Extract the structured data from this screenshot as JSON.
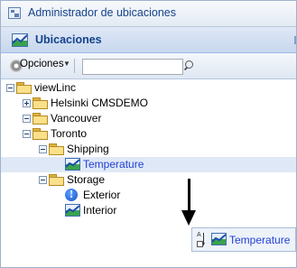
{
  "window": {
    "title": "Administrador de ubicaciones",
    "icon": "location-manager-icon"
  },
  "panel": {
    "title": "Ubicaciones",
    "icon": "chart-icon"
  },
  "toolbar": {
    "options_label": "Opciones",
    "options_icon": "gear-icon",
    "search_value": "",
    "search_icon": "search-icon"
  },
  "tree": {
    "root": "viewLinc",
    "helsinki": "Helsinki CMSDEMO",
    "vancouver": "Vancouver",
    "toronto": "Toronto",
    "shipping": "Shipping",
    "temperature": "Temperature",
    "storage": "Storage",
    "exterior": "Exterior",
    "interior": "Interior"
  },
  "drag": {
    "label": "Temperature"
  },
  "colors": {
    "accent": "#15428b",
    "link_blue": "#1f3fd6",
    "selection": "#dfe8f6",
    "folder": "#fbe08a"
  }
}
